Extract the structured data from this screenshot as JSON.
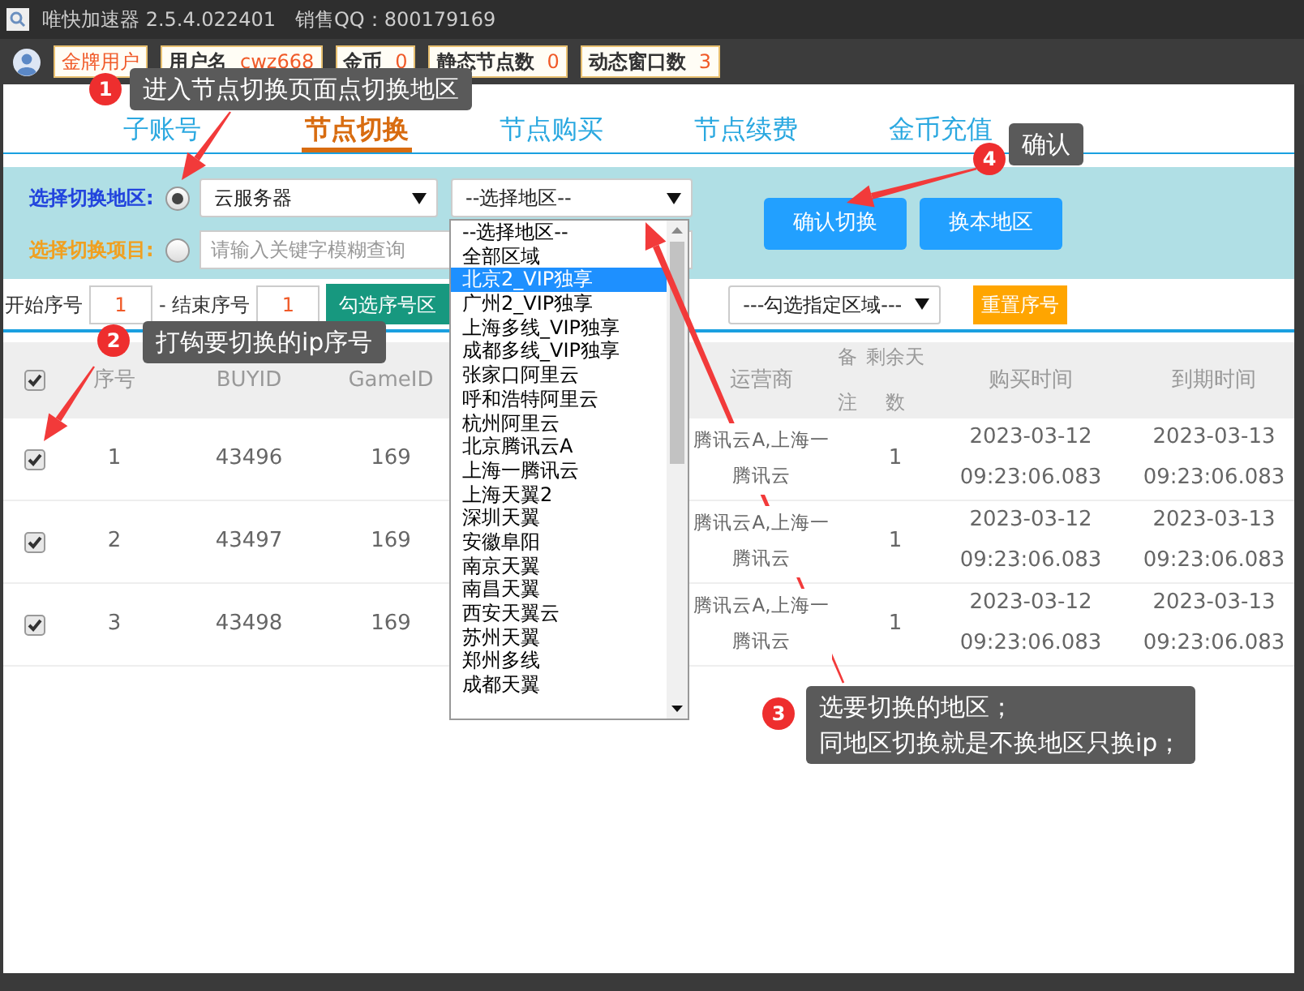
{
  "window": {
    "title": "唯快加速器 2.5.4.022401",
    "sales": "销售QQ：800179169"
  },
  "user_bar": [
    {
      "kind": "tier",
      "label": "金牌用户"
    },
    {
      "kind": "stat",
      "label": "用户名",
      "value": "cwz668"
    },
    {
      "kind": "stat",
      "label": "金币",
      "value": "0"
    },
    {
      "kind": "stat",
      "label": "静态节点数",
      "value": "0"
    },
    {
      "kind": "stat",
      "label": "动态窗口数",
      "value": "3"
    }
  ],
  "tabs": [
    {
      "label": "子账号",
      "selected": false
    },
    {
      "label": "节点切换",
      "selected": true
    },
    {
      "label": "节点购买",
      "selected": false
    },
    {
      "label": "节点续费",
      "selected": false
    },
    {
      "label": "金币充值",
      "selected": false
    }
  ],
  "switch_panel": {
    "region_row": {
      "label": "选择切换地区:",
      "selected": true,
      "type_select": "云服务器",
      "region_select": "--选择地区--"
    },
    "item_row": {
      "label": "选择切换项目:",
      "selected": false,
      "placeholder": "请输入关键字模糊查询"
    },
    "buttons": [
      "确认切换",
      "换本地区"
    ]
  },
  "range_row": {
    "start_label": "开始序号",
    "start_value": "1",
    "end_label": "- 结束序号",
    "end_value": "1",
    "range_button": "勾选序号区",
    "area_select": "---勾选指定区域---",
    "reset_button": "重置序号"
  },
  "table": {
    "select_all": true,
    "columns": [
      "序号",
      "BUYID",
      "GameID",
      "运营商",
      "备注",
      "剩余天数",
      "购买时间",
      "到期时间"
    ],
    "rows": [
      {
        "checked": true,
        "cells": [
          "1",
          "43496",
          "169",
          "腾讯云A,上海一腾讯云",
          "",
          "1",
          "2023-03-12 09:23:06.083",
          "2023-03-13 09:23:06.083"
        ]
      },
      {
        "checked": true,
        "cells": [
          "2",
          "43497",
          "169",
          "腾讯云A,上海一腾讯云",
          "",
          "1",
          "2023-03-12 09:23:06.083",
          "2023-03-13 09:23:06.083"
        ]
      },
      {
        "checked": true,
        "cells": [
          "3",
          "43498",
          "169",
          "腾讯云A,上海一腾讯云",
          "",
          "1",
          "2023-03-12 09:23:06.083",
          "2023-03-13 09:23:06.083"
        ]
      }
    ]
  },
  "region_dropdown": [
    {
      "label": "--选择地区--",
      "selected": false
    },
    {
      "label": "全部区域",
      "selected": false
    },
    {
      "label": "北京2_VIP独享",
      "selected": true
    },
    {
      "label": "广州2_VIP独享",
      "selected": false
    },
    {
      "label": "上海多线_VIP独享",
      "selected": false
    },
    {
      "label": "成都多线_VIP独享",
      "selected": false
    },
    {
      "label": "张家口阿里云",
      "selected": false
    },
    {
      "label": "呼和浩特阿里云",
      "selected": false
    },
    {
      "label": "杭州阿里云",
      "selected": false
    },
    {
      "label": "北京腾讯云A",
      "selected": false
    },
    {
      "label": "上海一腾讯云",
      "selected": false
    },
    {
      "label": "上海天翼2",
      "selected": false
    },
    {
      "label": "深圳天翼",
      "selected": false
    },
    {
      "label": "安徽阜阳",
      "selected": false
    },
    {
      "label": "南京天翼",
      "selected": false
    },
    {
      "label": "南昌天翼",
      "selected": false
    },
    {
      "label": "西安天翼云",
      "selected": false
    },
    {
      "label": "苏州天翼",
      "selected": false
    },
    {
      "label": "郑州多线",
      "selected": false
    },
    {
      "label": "成都天翼",
      "selected": false
    }
  ],
  "callouts": [
    {
      "number": "1",
      "lines": [
        "进入节点切换页面点切换地区"
      ]
    },
    {
      "number": "4",
      "lines": [
        "确认"
      ]
    },
    {
      "number": "2",
      "lines": [
        "打钩要切换的ip序号"
      ]
    },
    {
      "number": "3",
      "lines": [
        "选要切换的地区；",
        "同地区切换就是不换地区只换ip；"
      ]
    }
  ]
}
